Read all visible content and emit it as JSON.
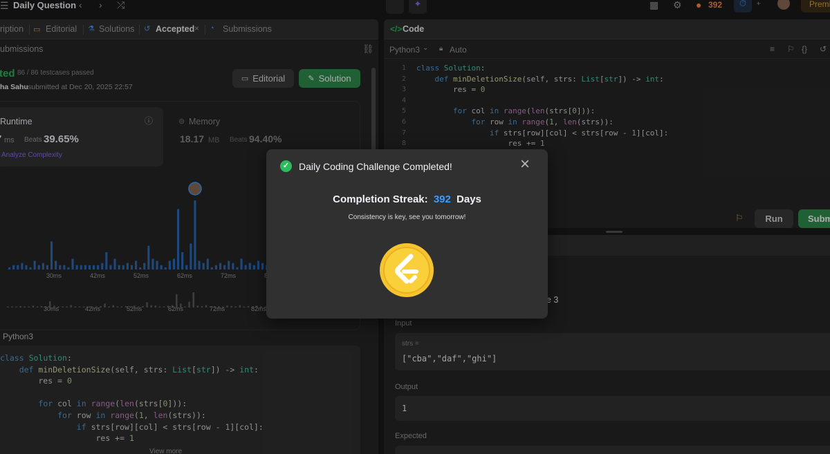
{
  "topbar": {
    "title": "Daily Question",
    "streak_count": "392",
    "premium_label": "Premi"
  },
  "left": {
    "tabs": {
      "description": "ription",
      "editorial": "Editorial",
      "solutions": "Solutions",
      "accepted": "Accepted",
      "submissions": "Submissions"
    },
    "subheader": "ubmissions",
    "status": {
      "label": "ted",
      "cases": "86 / 86 testcases passed",
      "author": "ha Sahu",
      "submitted": "submitted at Dec 20, 2025 22:57"
    },
    "buttons": {
      "editorial": "Editorial",
      "solution": "Solution"
    },
    "runtime": {
      "label": "Runtime",
      "value": "7",
      "unit": "ms",
      "beats_label": "Beats",
      "beats": "39.65%",
      "analyze": "Analyze Complexity"
    },
    "memory": {
      "label": "Memory",
      "value": "18.17",
      "unit": "MB",
      "beats_label": "Beats",
      "beats": "94.40%"
    },
    "chart_axis": [
      "30ms",
      "42ms",
      "52ms",
      "62ms",
      "72ms",
      "82m"
    ],
    "mini_axis": [
      "30ms",
      "42ms",
      "52ms",
      "62ms",
      "72ms",
      "82ms"
    ],
    "lang_label": "Python3",
    "code": [
      "class Solution:",
      "    def minDeletionSize(self, strs: List[str]) -> int:",
      "        res = 0",
      "",
      "        for col in range(len(strs[0])):",
      "            for row in range(1, len(strs)):",
      "                if strs[row][col] < strs[row - 1][col]:",
      "                    res += 1"
    ],
    "view_more": "View more"
  },
  "right": {
    "code_tab": "Code",
    "lang": "Python3",
    "auto": "Auto",
    "line_numbers": [
      "1",
      "2",
      "3",
      "4",
      "5",
      "6",
      "7",
      "8"
    ],
    "code": [
      "class Solution:",
      "    def minDeletionSize(self, strs: List[str]) -> int:",
      "        res = 0",
      "",
      "        for col in range(len(strs[0])):",
      "            for row in range(1, len(strs)):",
      "                if strs[row][col] < strs[row - 1][col]:",
      "                    res += 1"
    ],
    "run_label": "Run",
    "submit_label": "Subm",
    "case_fragment": "e 3",
    "input_label": "Input",
    "strs_label": "strs =",
    "strs_value": "[\"cba\",\"daf\",\"ghi\"]",
    "output_label": "Output",
    "output_value": "1",
    "expected_label": "Expected"
  },
  "modal": {
    "title": "Daily Coding Challenge Completed!",
    "streak_label": "Completion Streak:",
    "streak_value": "392",
    "streak_unit": "Days",
    "subtitle": "Consistency is key, see you tomorrow!"
  },
  "colors": {
    "accent_green": "#2cbb5d",
    "streak_blue": "#3b9dff",
    "coin_gold": "#f6c431",
    "bar_blue": "#2f6bb7"
  },
  "chart_data": {
    "type": "bar",
    "title": "",
    "x_ticks": [
      "30ms",
      "42ms",
      "52ms",
      "62ms",
      "72ms",
      "82m"
    ],
    "values": [
      1,
      2,
      2,
      3,
      2,
      1,
      4,
      2,
      3,
      2,
      13,
      4,
      2,
      2,
      1,
      5,
      2,
      2,
      2,
      2,
      2,
      2,
      3,
      8,
      2,
      5,
      2,
      2,
      3,
      2,
      4,
      1,
      3,
      11,
      5,
      4,
      2,
      1,
      4,
      5,
      28,
      8,
      2,
      12,
      32,
      4,
      3,
      5,
      1,
      2,
      3,
      2,
      4,
      3,
      1,
      5,
      2,
      3,
      2,
      4,
      3,
      2
    ],
    "highlight_index": 44
  }
}
